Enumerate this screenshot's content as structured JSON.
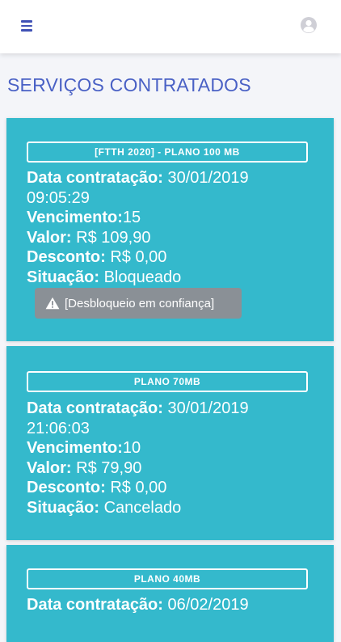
{
  "header": {
    "menu_icon": "hamburger-menu-icon",
    "profile_icon": "user-avatar-icon",
    "accent_color": "#3f51b5"
  },
  "page": {
    "title": "SERVIÇOS CONTRATADOS"
  },
  "labels": {
    "data_contratacao": "Data contratação:",
    "vencimento": "Vencimento:",
    "valor": "Valor:",
    "desconto": "Desconto:",
    "situacao": "Situação:"
  },
  "services": [
    {
      "plan": "[FTTH 2020] - PLANO 100 MB",
      "data_contratacao_date": "30/01/2019",
      "data_contratacao_time": "09:05:29",
      "vencimento": "15",
      "valor": "R$ 109,90",
      "desconto": "R$ 0,00",
      "situacao": "Bloqueado",
      "action": {
        "icon": "warning-icon",
        "label": "[Desbloqueio em confiança]"
      }
    },
    {
      "plan": "PLANO 70MB",
      "data_contratacao_date": "30/01/2019",
      "data_contratacao_time": "21:06:03",
      "vencimento": "10",
      "valor": "R$ 79,90",
      "desconto": "R$ 0,00",
      "situacao": "Cancelado"
    },
    {
      "plan": "PLANO 40MB",
      "data_contratacao_date": "06/02/2019"
    }
  ],
  "colors": {
    "card": "#34b9cc",
    "title": "#4a61c5",
    "alert_button": "#8a9096"
  }
}
